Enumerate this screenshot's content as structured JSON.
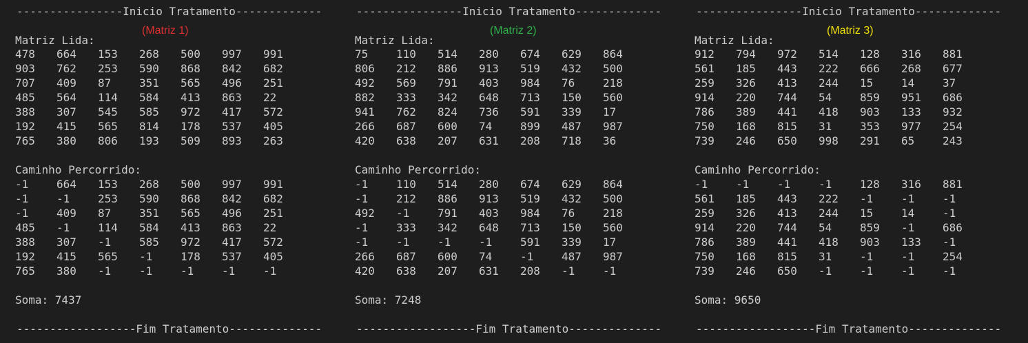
{
  "colors": {
    "background": "#1e1e1e",
    "text": "#cccccc",
    "tag_matrix_1": "#e03030",
    "tag_matrix_2": "#2fb34a",
    "tag_matrix_3": "#f2e10a"
  },
  "panels": [
    {
      "header": "----------------Inicio Tratamento-------------",
      "tag": "(Matriz 1)",
      "read_label": "Matriz Lida:",
      "read_matrix": [
        [
          "478",
          "664",
          "153",
          "268",
          "500",
          "997",
          "991"
        ],
        [
          "903",
          "762",
          "253",
          "590",
          "868",
          "842",
          "682"
        ],
        [
          "707",
          "409",
          "87",
          "351",
          "565",
          "496",
          "251"
        ],
        [
          "485",
          "564",
          "114",
          "584",
          "413",
          "863",
          "22"
        ],
        [
          "388",
          "307",
          "545",
          "585",
          "972",
          "417",
          "572"
        ],
        [
          "192",
          "415",
          "565",
          "814",
          "178",
          "537",
          "405"
        ],
        [
          "765",
          "380",
          "806",
          "193",
          "509",
          "893",
          "263"
        ]
      ],
      "path_label": "Caminho Percorrido:",
      "path_matrix": [
        [
          "-1",
          "664",
          "153",
          "268",
          "500",
          "997",
          "991"
        ],
        [
          "-1",
          "-1",
          "253",
          "590",
          "868",
          "842",
          "682"
        ],
        [
          "-1",
          "409",
          "87",
          "351",
          "565",
          "496",
          "251"
        ],
        [
          "485",
          "-1",
          "114",
          "584",
          "413",
          "863",
          "22"
        ],
        [
          "388",
          "307",
          "-1",
          "585",
          "972",
          "417",
          "572"
        ],
        [
          "192",
          "415",
          "565",
          "-1",
          "178",
          "537",
          "405"
        ],
        [
          "765",
          "380",
          "-1",
          "-1",
          "-1",
          "-1",
          "-1"
        ]
      ],
      "sum": "Soma: 7437",
      "footer": "------------------Fim Tratamento--------------"
    },
    {
      "header": "----------------Inicio Tratamento-------------",
      "tag": "(Matriz 2)",
      "read_label": "Matriz Lida:",
      "read_matrix": [
        [
          "75",
          "110",
          "514",
          "280",
          "674",
          "629",
          "864"
        ],
        [
          "806",
          "212",
          "886",
          "913",
          "519",
          "432",
          "500"
        ],
        [
          "492",
          "569",
          "791",
          "403",
          "984",
          "76",
          "218"
        ],
        [
          "882",
          "333",
          "342",
          "648",
          "713",
          "150",
          "560"
        ],
        [
          "941",
          "762",
          "824",
          "736",
          "591",
          "339",
          "17"
        ],
        [
          "266",
          "687",
          "600",
          "74",
          "899",
          "487",
          "987"
        ],
        [
          "420",
          "638",
          "207",
          "631",
          "208",
          "718",
          "36"
        ]
      ],
      "path_label": "Caminho Percorrido:",
      "path_matrix": [
        [
          "-1",
          "110",
          "514",
          "280",
          "674",
          "629",
          "864"
        ],
        [
          "-1",
          "212",
          "886",
          "913",
          "519",
          "432",
          "500"
        ],
        [
          "492",
          "-1",
          "791",
          "403",
          "984",
          "76",
          "218"
        ],
        [
          "-1",
          "333",
          "342",
          "648",
          "713",
          "150",
          "560"
        ],
        [
          "-1",
          "-1",
          "-1",
          "-1",
          "591",
          "339",
          "17"
        ],
        [
          "266",
          "687",
          "600",
          "74",
          "-1",
          "487",
          "987"
        ],
        [
          "420",
          "638",
          "207",
          "631",
          "208",
          "-1",
          "-1"
        ]
      ],
      "sum": "Soma: 7248",
      "footer": "------------------Fim Tratamento--------------"
    },
    {
      "header": "----------------Inicio Tratamento-------------",
      "tag": "(Matriz 3)",
      "read_label": "Matriz Lida:",
      "read_matrix": [
        [
          "912",
          "794",
          "972",
          "514",
          "128",
          "316",
          "881"
        ],
        [
          "561",
          "185",
          "443",
          "222",
          "666",
          "268",
          "677"
        ],
        [
          "259",
          "326",
          "413",
          "244",
          "15",
          "14",
          "37"
        ],
        [
          "914",
          "220",
          "744",
          "54",
          "859",
          "951",
          "686"
        ],
        [
          "786",
          "389",
          "441",
          "418",
          "903",
          "133",
          "932"
        ],
        [
          "750",
          "168",
          "815",
          "31",
          "353",
          "977",
          "254"
        ],
        [
          "739",
          "246",
          "650",
          "998",
          "291",
          "65",
          "243"
        ]
      ],
      "path_label": "Caminho Percorrido:",
      "path_matrix": [
        [
          "-1",
          "-1",
          "-1",
          "-1",
          "128",
          "316",
          "881"
        ],
        [
          "561",
          "185",
          "443",
          "222",
          "-1",
          "-1",
          "-1"
        ],
        [
          "259",
          "326",
          "413",
          "244",
          "15",
          "14",
          "-1"
        ],
        [
          "914",
          "220",
          "744",
          "54",
          "859",
          "-1",
          "686"
        ],
        [
          "786",
          "389",
          "441",
          "418",
          "903",
          "133",
          "-1"
        ],
        [
          "750",
          "168",
          "815",
          "31",
          "-1",
          "-1",
          "254"
        ],
        [
          "739",
          "246",
          "650",
          "-1",
          "-1",
          "-1",
          "-1"
        ]
      ],
      "sum": "Soma: 9650",
      "footer": "------------------Fim Tratamento--------------"
    }
  ]
}
